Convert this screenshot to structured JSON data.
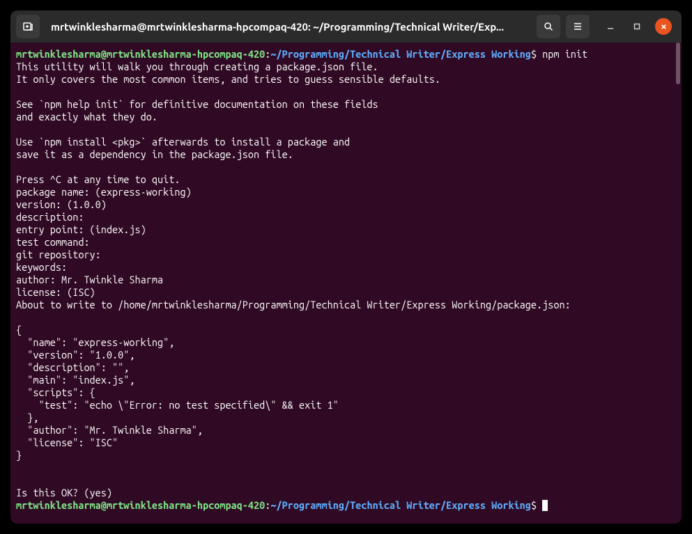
{
  "titlebar": {
    "title": "mrtwinklesharma@mrtwinklesharma-hpcompaq-420: ~/Programming/Technical Writer/Exp..."
  },
  "prompt1": {
    "user": "mrtwinklesharma@mrtwinklesharma-hpcompaq-420",
    "colon": ":",
    "path": "~/Programming/Technical Writer/Express Working",
    "dollar": "$",
    "command": " npm init"
  },
  "output": {
    "line1": "This utility will walk you through creating a package.json file.",
    "line2": "It only covers the most common items, and tries to guess sensible defaults.",
    "line3": "",
    "line4": "See `npm help init` for definitive documentation on these fields",
    "line5": "and exactly what they do.",
    "line6": "",
    "line7": "Use `npm install <pkg>` afterwards to install a package and",
    "line8": "save it as a dependency in the package.json file.",
    "line9": "",
    "line10": "Press ^C at any time to quit.",
    "line11": "package name: (express-working) ",
    "line12": "version: (1.0.0) ",
    "line13": "description: ",
    "line14": "entry point: (index.js) ",
    "line15": "test command: ",
    "line16": "git repository: ",
    "line17": "keywords: ",
    "line18": "author: Mr. Twinkle Sharma",
    "line19": "license: (ISC) ",
    "line20": "About to write to /home/mrtwinklesharma/Programming/Technical Writer/Express Working/package.json:",
    "line21": "",
    "line22": "{",
    "line23": "  \"name\": \"express-working\",",
    "line24": "  \"version\": \"1.0.0\",",
    "line25": "  \"description\": \"\",",
    "line26": "  \"main\": \"index.js\",",
    "line27": "  \"scripts\": {",
    "line28": "    \"test\": \"echo \\\"Error: no test specified\\\" && exit 1\"",
    "line29": "  },",
    "line30": "  \"author\": \"Mr. Twinkle Sharma\",",
    "line31": "  \"license\": \"ISC\"",
    "line32": "}",
    "line33": "",
    "line34": "",
    "line35": "Is this OK? (yes) "
  },
  "prompt2": {
    "user": "mrtwinklesharma@mrtwinklesharma-hpcompaq-420",
    "colon": ":",
    "path": "~/Programming/Technical Writer/Express Working",
    "dollar": "$ "
  }
}
